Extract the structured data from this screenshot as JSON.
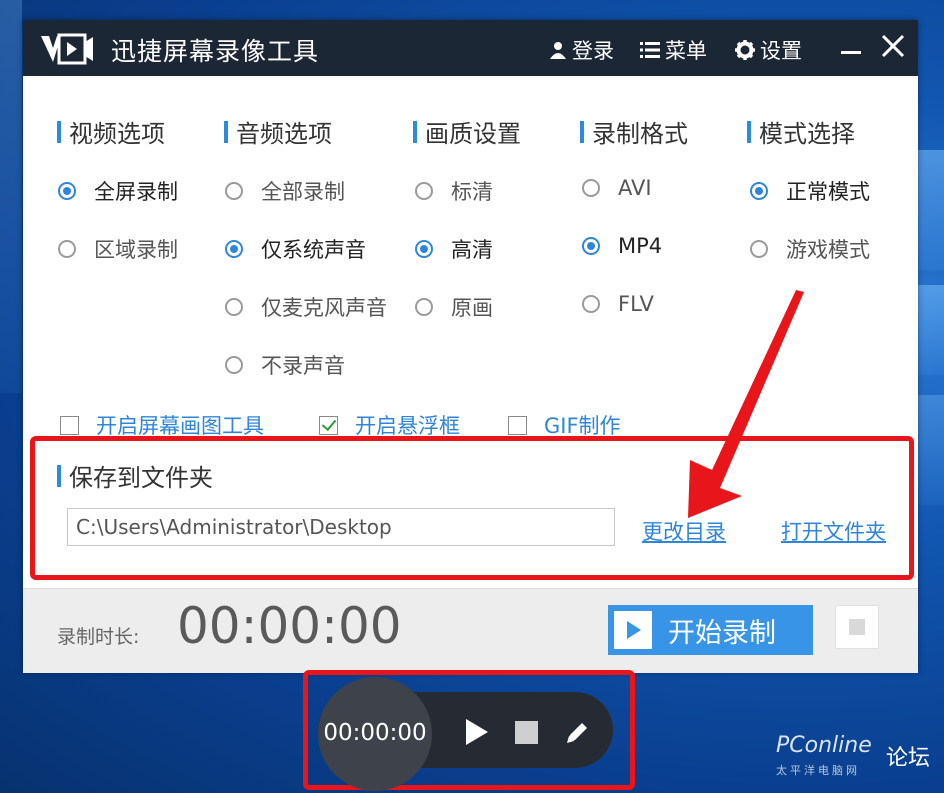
{
  "app": {
    "title": "迅捷屏幕录像工具",
    "login_label": "登录",
    "menu_label": "菜单",
    "settings_label": "设置"
  },
  "sections": {
    "video": {
      "heading": "视频选项",
      "options": [
        {
          "label": "全屏录制",
          "checked": true
        },
        {
          "label": "区域录制",
          "checked": false
        }
      ]
    },
    "audio": {
      "heading": "音频选项",
      "options": [
        {
          "label": "全部录制",
          "checked": false
        },
        {
          "label": "仅系统声音",
          "checked": true
        },
        {
          "label": "仅麦克风声音",
          "checked": false
        },
        {
          "label": "不录声音",
          "checked": false
        }
      ]
    },
    "quality": {
      "heading": "画质设置",
      "options": [
        {
          "label": "标清",
          "checked": false
        },
        {
          "label": "高清",
          "checked": true
        },
        {
          "label": "原画",
          "checked": false
        }
      ]
    },
    "format": {
      "heading": "录制格式",
      "options": [
        {
          "label": "AVI",
          "checked": false
        },
        {
          "label": "MP4",
          "checked": true
        },
        {
          "label": "FLV",
          "checked": false
        }
      ]
    },
    "mode": {
      "heading": "模式选择",
      "options": [
        {
          "label": "正常模式",
          "checked": true
        },
        {
          "label": "游戏模式",
          "checked": false
        }
      ]
    }
  },
  "extras": [
    {
      "label": "开启屏幕画图工具",
      "checked": false
    },
    {
      "label": "开启悬浮框",
      "checked": true
    },
    {
      "label": "GIF制作",
      "checked": false
    }
  ],
  "save": {
    "heading": "保存到文件夹",
    "path": "C:\\Users\\Administrator\\Desktop",
    "change_dir_label": "更改目录",
    "open_folder_label": "打开文件夹"
  },
  "footer": {
    "duration_label": "录制时长:",
    "duration_value": "00:00:00",
    "start_label": "开始录制"
  },
  "floating_bar": {
    "time": "00:00:00"
  },
  "watermark": {
    "brand": "PConline",
    "sub": "太平洋电脑网",
    "forum": "论坛"
  },
  "colors": {
    "accent": "#3794e6",
    "titlebar": "#1c2735",
    "highlight_border": "#e8151b",
    "arrow": "#e8151b"
  }
}
